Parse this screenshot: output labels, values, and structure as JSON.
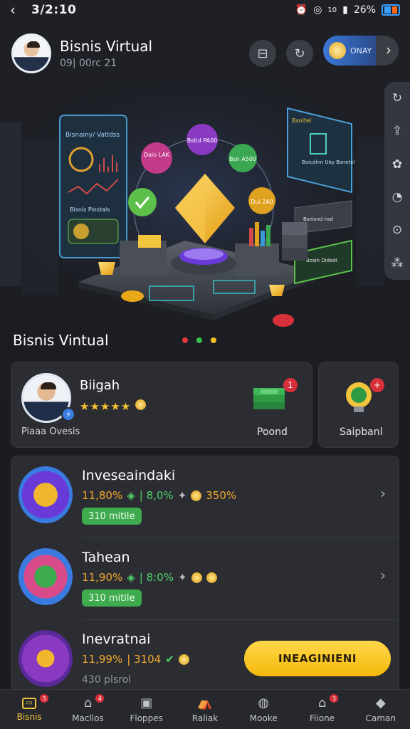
{
  "status_bar": {
    "time": "3/2:10",
    "battery": "26%",
    "signal_label": "10"
  },
  "header": {
    "title": "Bisnis Virtual",
    "subtitle": "09| 00rc 21",
    "pill_label": "ONAY"
  },
  "hero": {
    "left_panel_title": "Bisnainy/ Vatldss",
    "left_panel_text": "Bisnis Pinstals",
    "bubbles": [
      "Daio LAK",
      "Bstid PA00",
      "Bsn A500",
      "Dui 2A0"
    ],
    "right_panel_title": "Bsnitel",
    "right_panel_text": "Baicdinn Uby Bsnetel",
    "chart_panel_text": "Bsnisnd nsd",
    "growth_panel_text": "Bosin Didest"
  },
  "carousel": {
    "dot_colors": [
      "#e03a3a",
      "#3ac04a",
      "#f0c020"
    ]
  },
  "section_title": "Bisnis Vintual",
  "profile_card": {
    "name": "Biigah",
    "stars": "★★★★★",
    "subtitle": "Piaaa Ovesis",
    "pond_label": "Poond",
    "pond_badge": "1"
  },
  "side_card": {
    "label": "Saipbanl",
    "badge": "+"
  },
  "list": [
    {
      "title": "Inveseaindaki",
      "stat1": "11,80%",
      "stat2": "| 8,0%",
      "stat3": "350%",
      "tag": "310 mitile"
    },
    {
      "title": "Tahean",
      "stat1": "11,90%",
      "stat2": "| 8:0%",
      "tag": "310 mitile"
    },
    {
      "title": "Inevratnai",
      "stat1": "11,99%",
      "stat2": "| 3104",
      "tag": "430 plsrol"
    }
  ],
  "cta_label": "INEAGINIENI",
  "nav": [
    {
      "label": "Bisnis",
      "badge": "3",
      "icon": "briefcase-icon"
    },
    {
      "label": "Macllos",
      "badge": "4",
      "icon": "home-icon"
    },
    {
      "label": "Floppes",
      "badge": "",
      "icon": "frame-icon"
    },
    {
      "label": "Raliak",
      "badge": "",
      "icon": "tent-icon"
    },
    {
      "label": "Mooke",
      "badge": "",
      "icon": "globe-icon"
    },
    {
      "label": "Fiione",
      "badge": "3",
      "icon": "shop-icon"
    },
    {
      "label": "Caman",
      "badge": "",
      "icon": "chat-icon"
    }
  ],
  "colors": {
    "accent": "#f3c53a",
    "green_tag": "#3eab4f",
    "background": "#1b1d22"
  }
}
